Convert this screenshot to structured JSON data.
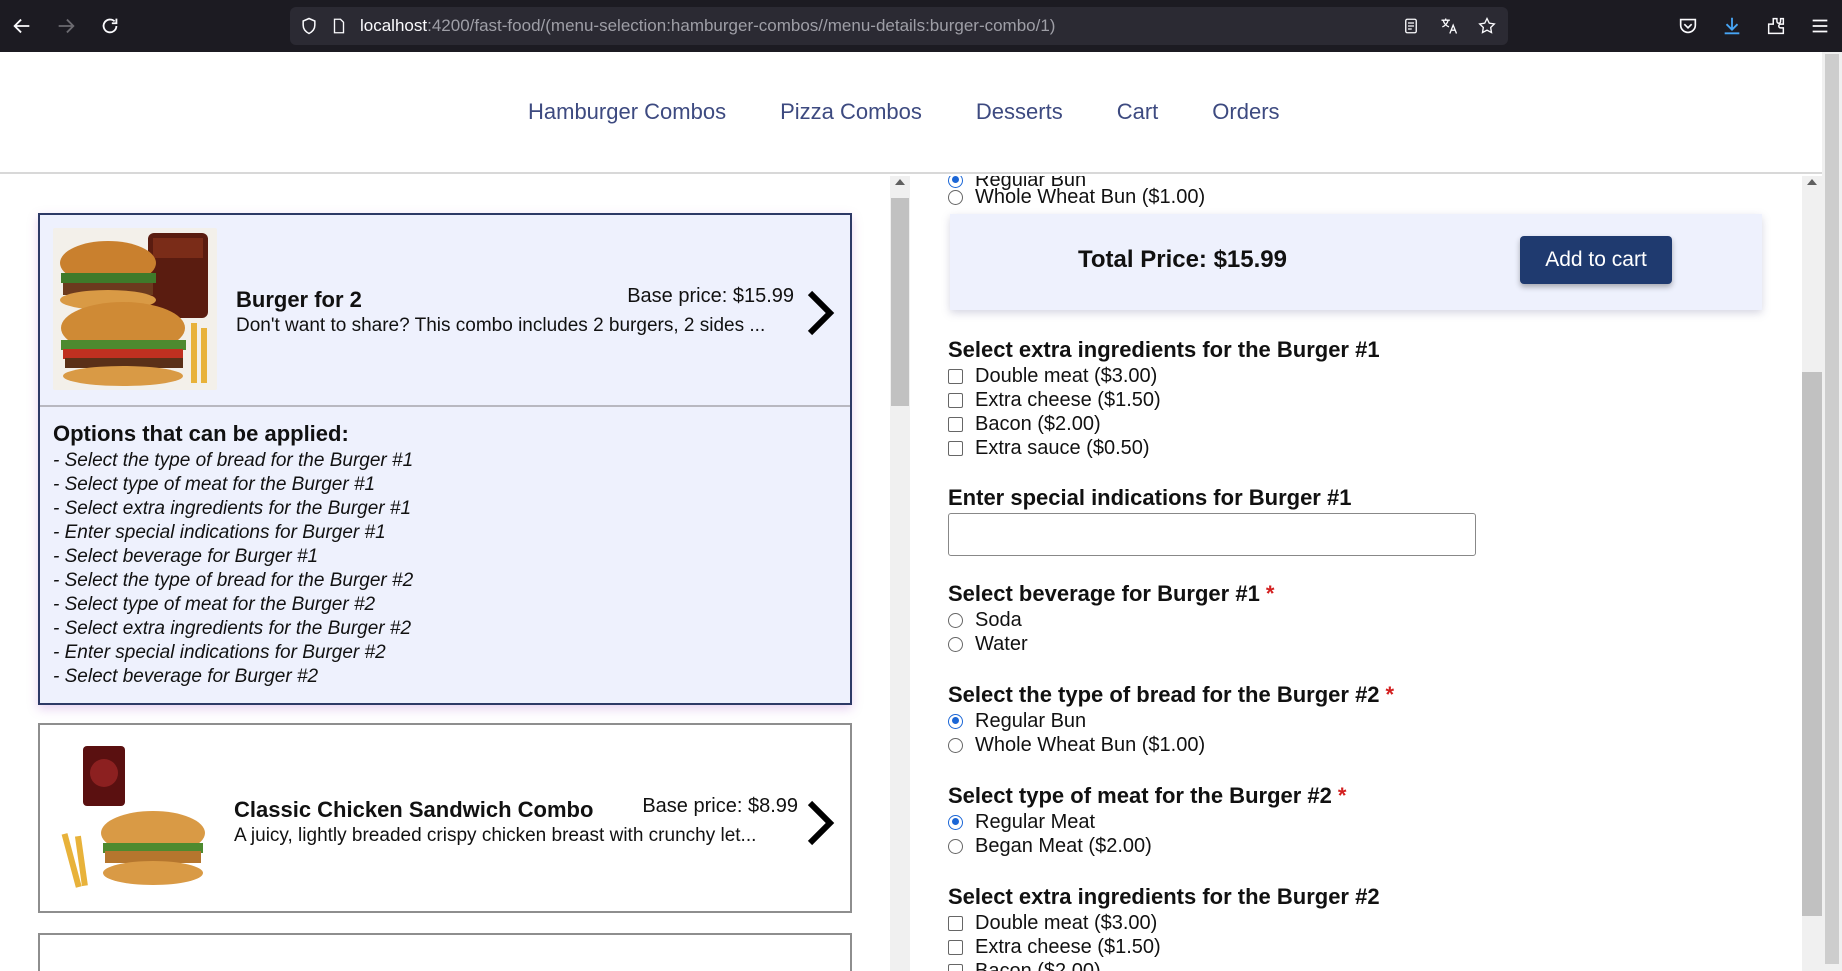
{
  "browser": {
    "url_host": "localhost",
    "url_path": ":4200/fast-food/(menu-selection:hamburger-combos//menu-details:burger-combo/1)"
  },
  "nav": {
    "items": [
      "Hamburger Combos",
      "Pizza Combos",
      "Desserts",
      "Cart",
      "Orders"
    ]
  },
  "combos": [
    {
      "name": "Burger for 2",
      "price": "Base price: $15.99",
      "description": "Don't want to share? This combo includes 2 burgers, 2 sides ...",
      "options_title": "Options that can be applied:",
      "options": [
        "- Select the type of bread for the Burger #1",
        "- Select type of meat for the Burger #1",
        "- Select extra ingredients for the Burger #1",
        "- Enter special indications for Burger #1",
        "- Select beverage for Burger #1",
        "- Select the type of bread for the Burger #2",
        "- Select type of meat for the Burger #2",
        "- Select extra ingredients for the Burger #2",
        "- Enter special indications for Burger #2",
        "- Select beverage for Burger #2"
      ]
    },
    {
      "name": "Classic Chicken Sandwich Combo",
      "price": "Base price: $8.99",
      "description": "A juicy, lightly breaded crispy chicken breast with crunchy let..."
    }
  ],
  "details": {
    "partial_top": "Regular Bun",
    "whole_wheat_top": "Whole Wheat Bun ($1.00)",
    "total_price": "Total Price: $15.99",
    "add_to_cart": "Add to cart",
    "extras1_title": "Select extra ingredients for the Burger #1",
    "extras1": [
      "Double meat ($3.00)",
      "Extra cheese ($1.50)",
      "Bacon ($2.00)",
      "Extra sauce ($0.50)"
    ],
    "special1_title": "Enter special indications for Burger #1",
    "beverage1_title": "Select beverage for Burger #1",
    "beverage1": [
      "Soda",
      "Water"
    ],
    "bread2_title": "Select the type of bread for the Burger #2",
    "bread2": [
      "Regular Bun",
      "Whole Wheat Bun ($1.00)"
    ],
    "meat2_title": "Select type of meat for the Burger #2",
    "meat2": [
      "Regular Meat",
      "Began Meat ($2.00)"
    ],
    "extras2_title": "Select extra ingredients for the Burger #2",
    "extras2": [
      "Double meat ($3.00)",
      "Extra cheese ($1.50)",
      "Bacon ($2.00)"
    ],
    "required_mark": "*"
  }
}
